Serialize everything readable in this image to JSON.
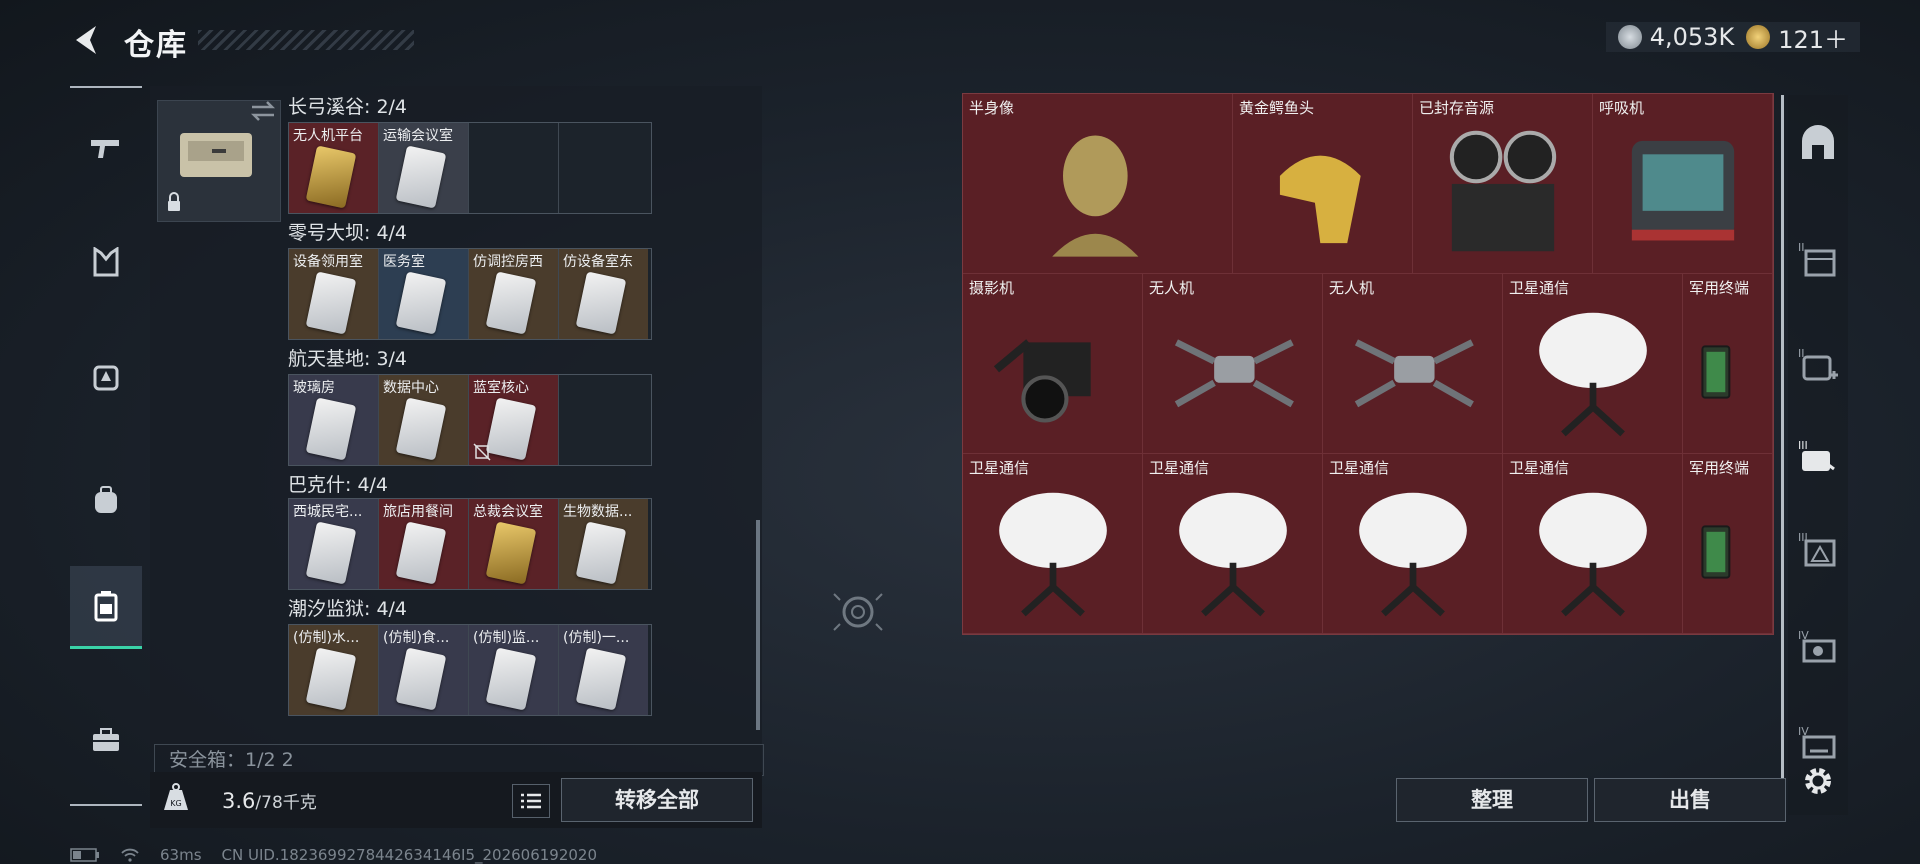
{
  "header": {
    "title": "仓库"
  },
  "currency": [
    {
      "name": "coin-silver-icon",
      "value": "4,053K",
      "color": "#a8b0b8"
    },
    {
      "name": "coin-gold-icon",
      "value": "121＋",
      "color": "#c8a24a"
    }
  ],
  "left_nav": [
    {
      "name": "gun-icon",
      "active": false
    },
    {
      "name": "armor-vest-icon",
      "active": false
    },
    {
      "name": "chest-rig-icon",
      "active": false
    },
    {
      "name": "backpack-icon",
      "active": false
    },
    {
      "name": "container-icon",
      "active": true
    },
    {
      "name": "toolbox-icon",
      "active": false
    }
  ],
  "groups": [
    {
      "header": "长弓溪谷: 2/4",
      "slots": [
        {
          "label": "无人机平台",
          "bg": "#5a2227",
          "card": "gold"
        },
        {
          "label": "运输会议室",
          "bg": "#3a3f4a",
          "card": "white"
        },
        {
          "label": "",
          "bg": "",
          "card": ""
        },
        {
          "label": "",
          "bg": "",
          "card": ""
        }
      ]
    },
    {
      "header": "零号大坝: 4/4",
      "slots": [
        {
          "label": "设备领用室",
          "bg": "#4a3c2c",
          "card": "white"
        },
        {
          "label": "医务室",
          "bg": "#2d3e52",
          "card": "white"
        },
        {
          "label": "仿调控房西",
          "bg": "#4a3c2c",
          "card": "white"
        },
        {
          "label": "仿设备室东",
          "bg": "#4a3c2c",
          "card": "white"
        }
      ]
    },
    {
      "header": "航天基地: 3/4",
      "slots": [
        {
          "label": "玻璃房",
          "bg": "#383a4c",
          "card": "white"
        },
        {
          "label": "数据中心",
          "bg": "#4a3c2c",
          "card": "white"
        },
        {
          "label": "蓝室核心",
          "bg": "#5a2227",
          "card": "white"
        },
        {
          "label": "",
          "bg": "",
          "card": ""
        }
      ]
    },
    {
      "header": "巴克什: 4/4",
      "slots": [
        {
          "label": "西城民宅...",
          "bg": "#383a4c",
          "card": "white"
        },
        {
          "label": "旅店用餐间",
          "bg": "#5a2227",
          "card": "white"
        },
        {
          "label": "总裁会议室",
          "bg": "#5a2227",
          "card": "gold"
        },
        {
          "label": "生物数据...",
          "bg": "#4a3c2c",
          "card": "white"
        }
      ]
    },
    {
      "header": "潮汐监狱: 4/4",
      "slots": [
        {
          "label": "(仿制)水...",
          "bg": "#4a3c2c",
          "card": "white"
        },
        {
          "label": "(仿制)食...",
          "bg": "#383a4c",
          "card": "white"
        },
        {
          "label": "(仿制)监...",
          "bg": "#383a4c",
          "card": "white"
        },
        {
          "label": "(仿制)一...",
          "bg": "#383a4c",
          "card": "white"
        }
      ]
    }
  ],
  "safe_box": "安全箱：1/2 2",
  "weight": {
    "current": "3.6",
    "capacity": "/78千克"
  },
  "buttons": {
    "transfer_all": "转移全部",
    "sort": "整理",
    "sell": "出售"
  },
  "stash_items": [
    {
      "label": "半身像",
      "icon": "bust-icon",
      "row": 0,
      "col": 0,
      "span": 1.5
    },
    {
      "label": "黄金鳄鱼头",
      "icon": "gold-crocodile-head-icon",
      "row": 0,
      "col": 1.5,
      "span": 1
    },
    {
      "label": "已封存音源",
      "icon": "reel-tape-recorder-icon",
      "row": 0,
      "col": 2.5,
      "span": 1
    },
    {
      "label": "呼吸机",
      "icon": "ventilator-icon",
      "row": 0,
      "col": 3.5,
      "span": 1
    },
    {
      "label": "摄影机",
      "icon": "camera-icon",
      "row": 1,
      "col": 0,
      "span": 1
    },
    {
      "label": "无人机",
      "icon": "drone-icon",
      "row": 1,
      "col": 1,
      "span": 1
    },
    {
      "label": "无人机",
      "icon": "drone-icon",
      "row": 1,
      "col": 2,
      "span": 1
    },
    {
      "label": "卫星通信",
      "icon": "satellite-dish-icon",
      "row": 1,
      "col": 3,
      "span": 1
    },
    {
      "label": "军用终端",
      "icon": "military-terminal-icon",
      "row": 1,
      "col": 4,
      "span": 0.5
    },
    {
      "label": "卫星通信",
      "icon": "satellite-dish-icon",
      "row": 2,
      "col": 0,
      "span": 1
    },
    {
      "label": "卫星通信",
      "icon": "satellite-dish-icon",
      "row": 2,
      "col": 1,
      "span": 1
    },
    {
      "label": "卫星通信",
      "icon": "satellite-dish-icon",
      "row": 2,
      "col": 2,
      "span": 1
    },
    {
      "label": "卫星通信",
      "icon": "satellite-dish-icon",
      "row": 2,
      "col": 3,
      "span": 1
    },
    {
      "label": "军用终端",
      "icon": "military-terminal-icon",
      "row": 2,
      "col": 4,
      "span": 0.5
    }
  ],
  "right_nav": [
    {
      "name": "stash-home-icon",
      "tier": ""
    },
    {
      "name": "storage-tier-2-icon",
      "tier": "II"
    },
    {
      "name": "medical-tier-2-icon",
      "tier": "II"
    },
    {
      "name": "hand-tier-3-icon",
      "tier": "III"
    },
    {
      "name": "storage-tier-3-icon",
      "tier": "III"
    },
    {
      "name": "workbench-tier-4-icon",
      "tier": "IV"
    },
    {
      "name": "workbench-tier-4b-icon",
      "tier": "IV"
    },
    {
      "name": "settings-gear-icon",
      "tier": ""
    }
  ],
  "status": {
    "ping": "63ms",
    "uid": "CN UID.1823699278442634146I5_202606192020"
  }
}
